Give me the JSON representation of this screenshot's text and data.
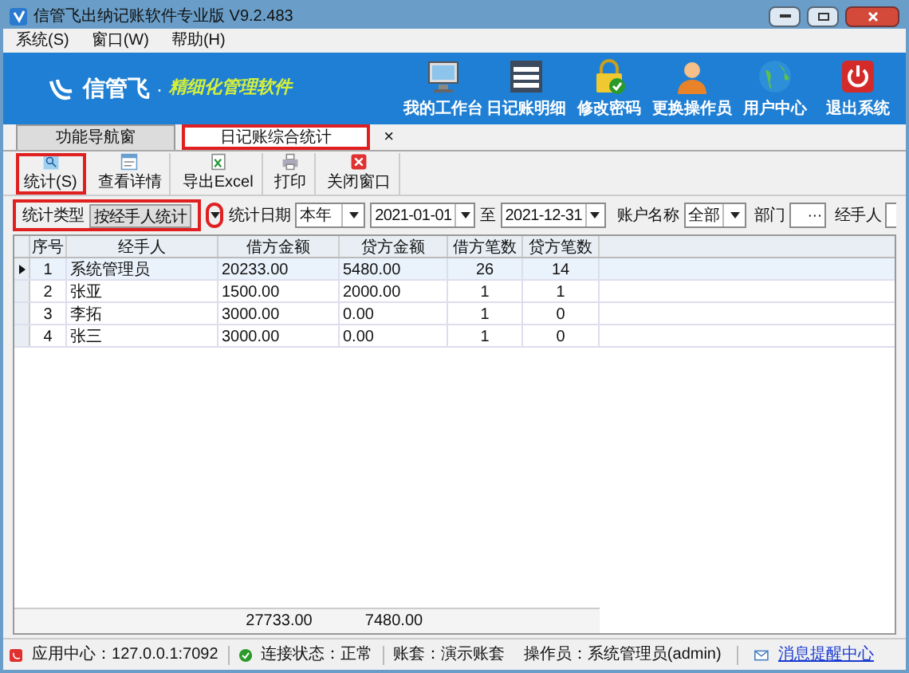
{
  "window": {
    "title": "信管飞出纳记账软件专业版 V9.2.483"
  },
  "menu": [
    "系统(S)",
    "窗口(W)",
    "帮助(H)"
  ],
  "banner": {
    "brand": "信管飞",
    "separator": "·",
    "slogan": "精细化管理软件",
    "buttons": [
      {
        "label": "我的工作台",
        "kind": "monitor"
      },
      {
        "label": "日记账明细",
        "kind": "list"
      },
      {
        "label": "修改密码",
        "kind": "lock"
      },
      {
        "label": "更换操作员",
        "kind": "user"
      },
      {
        "label": "用户中心",
        "kind": "globe"
      },
      {
        "label": "退出系统",
        "kind": "power"
      }
    ]
  },
  "tabs": [
    {
      "label": "功能导航窗",
      "selected": false,
      "highlighted": false
    },
    {
      "label": "日记账综合统计",
      "selected": true,
      "highlighted": true,
      "close_symbol": "×"
    }
  ],
  "toolbar": [
    {
      "label": "统计(S)",
      "kind": "stats",
      "highlighted": true
    },
    {
      "label": "查看详情",
      "kind": "details",
      "highlighted": false
    },
    {
      "label": "导出Excel",
      "kind": "excel",
      "highlighted": false
    },
    {
      "label": "打印",
      "kind": "print",
      "highlighted": false
    },
    {
      "label": "关闭窗口",
      "kind": "close",
      "highlighted": false
    }
  ],
  "filters": {
    "type_label": "统计类型",
    "type_value": "按经手人统计",
    "type_highlighted": true,
    "date_label": "统计日期",
    "date_value": "本年",
    "date_from": "2021-01-01",
    "date_sep": "至",
    "date_to": "2021-12-31",
    "account_label": "账户名称",
    "account_value": "全部",
    "dept_label": "部门",
    "dept_button": "···",
    "handler_label": "经手人"
  },
  "table": {
    "columns": [
      "序号",
      "经手人",
      "借方金额",
      "贷方金额",
      "借方笔数",
      "贷方笔数"
    ],
    "rows": [
      {
        "cells": [
          "1",
          "系统管理员",
          "20233.00",
          "5480.00",
          "26",
          "14"
        ],
        "selected": true
      },
      {
        "cells": [
          "2",
          "张亚",
          "1500.00",
          "2000.00",
          "1",
          "1"
        ],
        "selected": false
      },
      {
        "cells": [
          "3",
          "李拓",
          "3000.00",
          "0.00",
          "1",
          "0"
        ],
        "selected": false
      },
      {
        "cells": [
          "4",
          "张三",
          "3000.00",
          "0.00",
          "1",
          "0"
        ],
        "selected": false
      }
    ],
    "debit_total": "27733.00",
    "credit_total": "7480.00"
  },
  "status_bar": {
    "app_center": "应用中心：127.0.0.1:7092",
    "connection": "连接状态：正常",
    "account_set": "账套：演示账套",
    "operator": "操作员：系统管理员(admin)",
    "messages": "消息提醒中心"
  }
}
